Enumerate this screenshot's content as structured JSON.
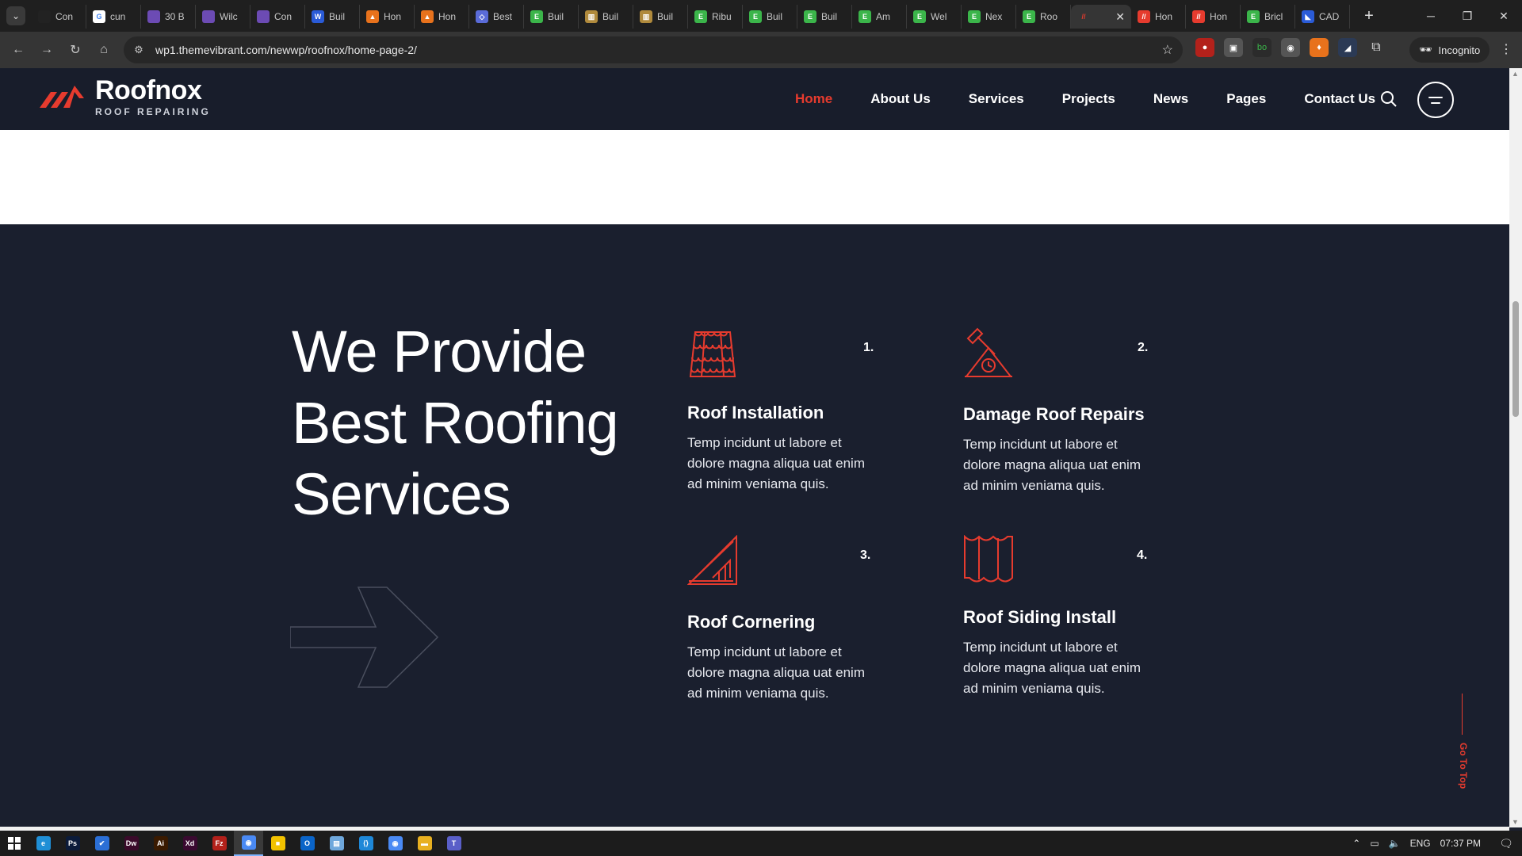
{
  "browser": {
    "tabs": [
      {
        "label": "Con",
        "fav_color": "#222222",
        "fav_glyph": ""
      },
      {
        "label": "cun",
        "fav_color": "#ffffff",
        "fav_glyph": "G"
      },
      {
        "label": "30 B",
        "fav_color": "#6c4bb4",
        "fav_glyph": ""
      },
      {
        "label": "Wilc",
        "fav_color": "#6c4bb4",
        "fav_glyph": ""
      },
      {
        "label": "Con",
        "fav_color": "#6c4bb4",
        "fav_glyph": ""
      },
      {
        "label": "Buil",
        "fav_color": "#2a5bd7",
        "fav_glyph": "W"
      },
      {
        "label": "Hon",
        "fav_color": "#e8721c",
        "fav_glyph": "▲"
      },
      {
        "label": "Hon",
        "fav_color": "#e8721c",
        "fav_glyph": "▲"
      },
      {
        "label": "Best",
        "fav_color": "#5a6bd8",
        "fav_glyph": "◇"
      },
      {
        "label": "Buil",
        "fav_color": "#3bb54a",
        "fav_glyph": "E"
      },
      {
        "label": "Buil",
        "fav_color": "#b08a3c",
        "fav_glyph": "▥"
      },
      {
        "label": "Buil",
        "fav_color": "#b08a3c",
        "fav_glyph": "▥"
      },
      {
        "label": "Ribu",
        "fav_color": "#3bb54a",
        "fav_glyph": "E"
      },
      {
        "label": "Buil",
        "fav_color": "#3bb54a",
        "fav_glyph": "E"
      },
      {
        "label": "Buil",
        "fav_color": "#3bb54a",
        "fav_glyph": "E"
      },
      {
        "label": "Am",
        "fav_color": "#3bb54a",
        "fav_glyph": "E"
      },
      {
        "label": "Wel",
        "fav_color": "#3bb54a",
        "fav_glyph": "E"
      },
      {
        "label": "Nex",
        "fav_color": "#3bb54a",
        "fav_glyph": "E"
      },
      {
        "label": "Roo",
        "fav_color": "#3bb54a",
        "fav_glyph": "E"
      }
    ],
    "active_tab": {
      "label": "",
      "fav_color": "#e63b2e",
      "close": "✕"
    },
    "tabs_after": [
      {
        "label": "Hon",
        "fav_color": "#e63b2e",
        "fav_glyph": "//"
      },
      {
        "label": "Hon",
        "fav_color": "#e63b2e",
        "fav_glyph": "//"
      },
      {
        "label": "Bricl",
        "fav_color": "#3bb54a",
        "fav_glyph": "E"
      },
      {
        "label": "CAD",
        "fav_color": "#2a5bd7",
        "fav_glyph": "◣"
      }
    ],
    "new_tab": "+",
    "url": "wp1.themevibrant.com/newwp/roofnox/home-page-2/",
    "incognito_label": "Incognito"
  },
  "site": {
    "logo_name": "Roofnox",
    "logo_tagline": "ROOF REPAIRING",
    "nav": [
      "Home",
      "About Us",
      "Services",
      "Projects",
      "News",
      "Pages",
      "Contact Us"
    ],
    "accent": "#e63b2e",
    "headline": {
      "line1": "We Provide",
      "line2_a": "Best ",
      "line2_b": "Roofing",
      "line3": "Services"
    },
    "services": [
      {
        "num": "1.",
        "title": "Roof Installation",
        "desc": "Temp incidunt ut labore et dolore magna aliqua uat enim ad minim veniama quis.",
        "icon": "roof-tiles-icon"
      },
      {
        "num": "2.",
        "title": "Damage Roof Repairs",
        "desc": "Temp incidunt ut labore et dolore magna aliqua uat enim ad minim veniama quis.",
        "icon": "hammer-roof-icon"
      },
      {
        "num": "3.",
        "title": "Roof Cornering",
        "desc": "Temp incidunt ut labore et dolore magna aliqua uat enim ad minim veniama quis.",
        "icon": "roof-corner-icon"
      },
      {
        "num": "4.",
        "title": "Roof Siding Install",
        "desc": "Temp incidunt ut labore et dolore magna aliqua uat enim ad minim veniama quis.",
        "icon": "siding-panel-icon"
      }
    ],
    "go_to_top": "Go To Top"
  },
  "taskbar": {
    "apps": [
      {
        "name": "edge",
        "color": "#1f8fd6",
        "glyph": "e"
      },
      {
        "name": "photoshop",
        "color": "#0b1b3a",
        "glyph": "Ps"
      },
      {
        "name": "todo",
        "color": "#2b6fd6",
        "glyph": "✔"
      },
      {
        "name": "dreamweaver",
        "color": "#3a0a2a",
        "glyph": "Dw"
      },
      {
        "name": "illustrator",
        "color": "#3a1a00",
        "glyph": "Ai"
      },
      {
        "name": "xd",
        "color": "#3a0a30",
        "glyph": "Xd"
      },
      {
        "name": "filezilla",
        "color": "#b3211b",
        "glyph": "Fz"
      },
      {
        "name": "chrome",
        "color": "#4a8af4",
        "glyph": "◉"
      },
      {
        "name": "sticky-notes",
        "color": "#f2c200",
        "glyph": "■"
      },
      {
        "name": "outlook",
        "color": "#0a64c8",
        "glyph": "O"
      },
      {
        "name": "notepad",
        "color": "#6fa8dc",
        "glyph": "▤"
      },
      {
        "name": "vscode",
        "color": "#1e88d8",
        "glyph": "⟨⟩"
      },
      {
        "name": "chrome-2",
        "color": "#4a8af4",
        "glyph": "◉"
      },
      {
        "name": "file-explorer",
        "color": "#e8b020",
        "glyph": "▬"
      },
      {
        "name": "teams",
        "color": "#5a5fc8",
        "glyph": "T"
      }
    ],
    "active_app": "chrome",
    "language": "ENG",
    "time": "07:37 PM"
  }
}
